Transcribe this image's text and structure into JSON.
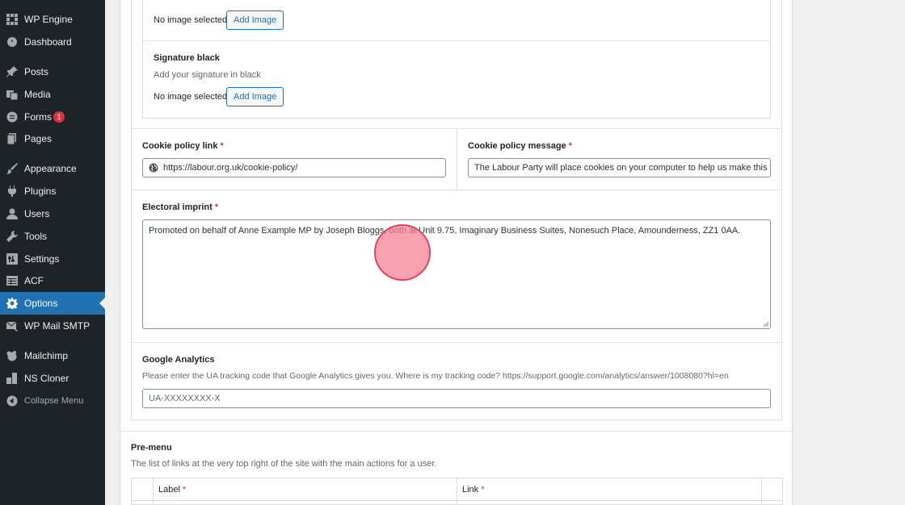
{
  "sidebar": {
    "items": [
      {
        "label": "WP Engine",
        "icon": "wp-engine-icon",
        "badge": null
      },
      {
        "label": "Dashboard",
        "icon": "dashboard-icon",
        "badge": null
      },
      {
        "label": "Posts",
        "icon": "pin-icon",
        "badge": null
      },
      {
        "label": "Media",
        "icon": "media-icon",
        "badge": null
      },
      {
        "label": "Forms",
        "icon": "forms-icon",
        "badge": "1"
      },
      {
        "label": "Pages",
        "icon": "pages-icon",
        "badge": null
      },
      {
        "label": "Appearance",
        "icon": "brush-icon",
        "badge": null
      },
      {
        "label": "Plugins",
        "icon": "plug-icon",
        "badge": null
      },
      {
        "label": "Users",
        "icon": "user-icon",
        "badge": null
      },
      {
        "label": "Tools",
        "icon": "wrench-icon",
        "badge": null
      },
      {
        "label": "Settings",
        "icon": "settings-icon",
        "badge": null
      },
      {
        "label": "ACF",
        "icon": "table-icon",
        "badge": null
      },
      {
        "label": "Options",
        "icon": "gear-icon",
        "badge": null,
        "active": true
      },
      {
        "label": "WP Mail SMTP",
        "icon": "mail-icon",
        "badge": null
      },
      {
        "label": "Mailchimp",
        "icon": "mailchimp-icon",
        "badge": null
      },
      {
        "label": "NS Cloner",
        "icon": "cloner-icon",
        "badge": null
      },
      {
        "label": "Collapse Menu",
        "icon": "collapse-icon",
        "badge": null
      }
    ],
    "active_color": "#2271b1",
    "bg_color": "#1d2327"
  },
  "signature_white": {
    "status": "No image selected",
    "button": "Add Image"
  },
  "signature_black": {
    "label": "Signature black",
    "description": "Add your signature in black",
    "status": "No image selected",
    "button": "Add Image"
  },
  "cookie_link": {
    "label": "Cookie policy link",
    "required": "*",
    "value": "https://labour.org.uk/cookie-policy/"
  },
  "cookie_message": {
    "label": "Cookie policy message",
    "required": "*",
    "value": "The Labour Party will place cookies on your computer to help us make this website better."
  },
  "electoral_imprint": {
    "label": "Electoral imprint",
    "required": "*",
    "value": "Promoted on behalf of Anne Example MP by Joseph Bloggs, both at Unit 9.75, Imaginary Business Suites, Nonesuch Place, Amounderness, ZZ1 0AA."
  },
  "google_analytics": {
    "label": "Google Analytics",
    "description": "Please enter the UA tracking code that Google Analytics gives you. Where is my tracking code? https://support.google.com/analytics/answer/1008080?hl=en",
    "placeholder": "UA-XXXXXXXX-X"
  },
  "pre_menu": {
    "label": "Pre-menu",
    "description": "The list of links at the very top right of the site with the main actions for a user.",
    "columns": [
      {
        "label": "Label",
        "required": "*"
      },
      {
        "label": "Link",
        "required": "*"
      }
    ]
  }
}
